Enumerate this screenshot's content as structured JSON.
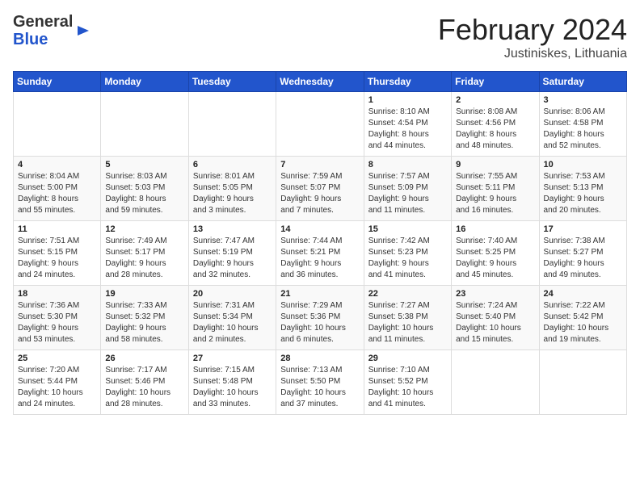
{
  "header": {
    "logo_general": "General",
    "logo_blue": "Blue",
    "month_title": "February 2024",
    "location": "Justiniskes, Lithuania"
  },
  "days_of_week": [
    "Sunday",
    "Monday",
    "Tuesday",
    "Wednesday",
    "Thursday",
    "Friday",
    "Saturday"
  ],
  "weeks": [
    [
      {
        "num": "",
        "info": ""
      },
      {
        "num": "",
        "info": ""
      },
      {
        "num": "",
        "info": ""
      },
      {
        "num": "",
        "info": ""
      },
      {
        "num": "1",
        "info": "Sunrise: 8:10 AM\nSunset: 4:54 PM\nDaylight: 8 hours\nand 44 minutes."
      },
      {
        "num": "2",
        "info": "Sunrise: 8:08 AM\nSunset: 4:56 PM\nDaylight: 8 hours\nand 48 minutes."
      },
      {
        "num": "3",
        "info": "Sunrise: 8:06 AM\nSunset: 4:58 PM\nDaylight: 8 hours\nand 52 minutes."
      }
    ],
    [
      {
        "num": "4",
        "info": "Sunrise: 8:04 AM\nSunset: 5:00 PM\nDaylight: 8 hours\nand 55 minutes."
      },
      {
        "num": "5",
        "info": "Sunrise: 8:03 AM\nSunset: 5:03 PM\nDaylight: 8 hours\nand 59 minutes."
      },
      {
        "num": "6",
        "info": "Sunrise: 8:01 AM\nSunset: 5:05 PM\nDaylight: 9 hours\nand 3 minutes."
      },
      {
        "num": "7",
        "info": "Sunrise: 7:59 AM\nSunset: 5:07 PM\nDaylight: 9 hours\nand 7 minutes."
      },
      {
        "num": "8",
        "info": "Sunrise: 7:57 AM\nSunset: 5:09 PM\nDaylight: 9 hours\nand 11 minutes."
      },
      {
        "num": "9",
        "info": "Sunrise: 7:55 AM\nSunset: 5:11 PM\nDaylight: 9 hours\nand 16 minutes."
      },
      {
        "num": "10",
        "info": "Sunrise: 7:53 AM\nSunset: 5:13 PM\nDaylight: 9 hours\nand 20 minutes."
      }
    ],
    [
      {
        "num": "11",
        "info": "Sunrise: 7:51 AM\nSunset: 5:15 PM\nDaylight: 9 hours\nand 24 minutes."
      },
      {
        "num": "12",
        "info": "Sunrise: 7:49 AM\nSunset: 5:17 PM\nDaylight: 9 hours\nand 28 minutes."
      },
      {
        "num": "13",
        "info": "Sunrise: 7:47 AM\nSunset: 5:19 PM\nDaylight: 9 hours\nand 32 minutes."
      },
      {
        "num": "14",
        "info": "Sunrise: 7:44 AM\nSunset: 5:21 PM\nDaylight: 9 hours\nand 36 minutes."
      },
      {
        "num": "15",
        "info": "Sunrise: 7:42 AM\nSunset: 5:23 PM\nDaylight: 9 hours\nand 41 minutes."
      },
      {
        "num": "16",
        "info": "Sunrise: 7:40 AM\nSunset: 5:25 PM\nDaylight: 9 hours\nand 45 minutes."
      },
      {
        "num": "17",
        "info": "Sunrise: 7:38 AM\nSunset: 5:27 PM\nDaylight: 9 hours\nand 49 minutes."
      }
    ],
    [
      {
        "num": "18",
        "info": "Sunrise: 7:36 AM\nSunset: 5:30 PM\nDaylight: 9 hours\nand 53 minutes."
      },
      {
        "num": "19",
        "info": "Sunrise: 7:33 AM\nSunset: 5:32 PM\nDaylight: 9 hours\nand 58 minutes."
      },
      {
        "num": "20",
        "info": "Sunrise: 7:31 AM\nSunset: 5:34 PM\nDaylight: 10 hours\nand 2 minutes."
      },
      {
        "num": "21",
        "info": "Sunrise: 7:29 AM\nSunset: 5:36 PM\nDaylight: 10 hours\nand 6 minutes."
      },
      {
        "num": "22",
        "info": "Sunrise: 7:27 AM\nSunset: 5:38 PM\nDaylight: 10 hours\nand 11 minutes."
      },
      {
        "num": "23",
        "info": "Sunrise: 7:24 AM\nSunset: 5:40 PM\nDaylight: 10 hours\nand 15 minutes."
      },
      {
        "num": "24",
        "info": "Sunrise: 7:22 AM\nSunset: 5:42 PM\nDaylight: 10 hours\nand 19 minutes."
      }
    ],
    [
      {
        "num": "25",
        "info": "Sunrise: 7:20 AM\nSunset: 5:44 PM\nDaylight: 10 hours\nand 24 minutes."
      },
      {
        "num": "26",
        "info": "Sunrise: 7:17 AM\nSunset: 5:46 PM\nDaylight: 10 hours\nand 28 minutes."
      },
      {
        "num": "27",
        "info": "Sunrise: 7:15 AM\nSunset: 5:48 PM\nDaylight: 10 hours\nand 33 minutes."
      },
      {
        "num": "28",
        "info": "Sunrise: 7:13 AM\nSunset: 5:50 PM\nDaylight: 10 hours\nand 37 minutes."
      },
      {
        "num": "29",
        "info": "Sunrise: 7:10 AM\nSunset: 5:52 PM\nDaylight: 10 hours\nand 41 minutes."
      },
      {
        "num": "",
        "info": ""
      },
      {
        "num": "",
        "info": ""
      }
    ]
  ]
}
